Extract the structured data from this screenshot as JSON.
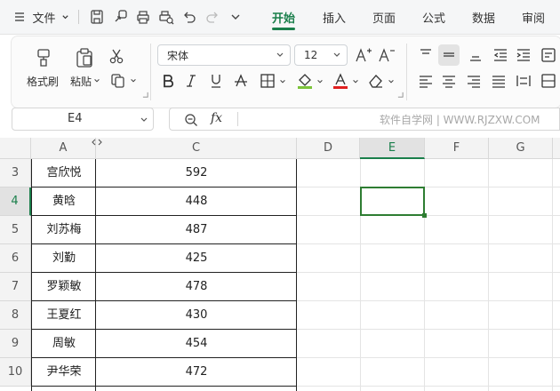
{
  "topbar": {
    "menu_label": "文件",
    "tabs": [
      {
        "label": "开始",
        "active": true
      },
      {
        "label": "插入",
        "active": false
      },
      {
        "label": "页面",
        "active": false
      },
      {
        "label": "公式",
        "active": false
      },
      {
        "label": "数据",
        "active": false
      },
      {
        "label": "审阅",
        "active": false
      }
    ]
  },
  "ribbon": {
    "format_painter_label": "格式刷",
    "paste_label": "粘贴",
    "font_name": "宋体",
    "font_size": "12"
  },
  "formula_bar": {
    "cell_ref": "E4",
    "fx_label": "fx",
    "watermark": "软件自学网 | WWW.RJZXW.COM"
  },
  "sheet": {
    "columns": [
      "A",
      "C",
      "D",
      "E",
      "F",
      "G"
    ],
    "selected_column": "E",
    "selected_cell": "E4",
    "rows": [
      {
        "num": "3",
        "name": "宫欣悦",
        "value": "592"
      },
      {
        "num": "4",
        "name": "黄晗",
        "value": "448"
      },
      {
        "num": "5",
        "name": "刘苏梅",
        "value": "487"
      },
      {
        "num": "6",
        "name": "刘勤",
        "value": "425"
      },
      {
        "num": "7",
        "name": "罗颖敏",
        "value": "478"
      },
      {
        "num": "8",
        "name": "王夏红",
        "value": "430"
      },
      {
        "num": "9",
        "name": "周敏",
        "value": "454"
      },
      {
        "num": "10",
        "name": "尹华荣",
        "value": "472"
      }
    ]
  },
  "colors": {
    "accent": "#1a7f4b"
  }
}
